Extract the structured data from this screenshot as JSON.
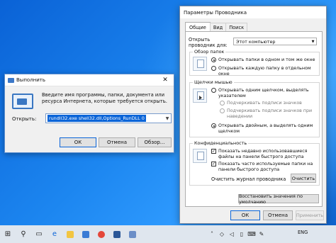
{
  "run_dialog": {
    "title": "Выполнить",
    "description": "Введите имя программы, папки, документа или ресурса Интернета, которые требуется открыть.",
    "open_label": "Открыть:",
    "open_value": "rundll32.exe shell32.dll,Options_RunDLL 0",
    "ok_label": "ОК",
    "cancel_label": "Отмена",
    "browse_label": "Обзор..."
  },
  "folder_options": {
    "title": "Параметры Проводника",
    "tabs": [
      "Общие",
      "Вид",
      "Поиск"
    ],
    "open_explorer_for_label": "Открыть проводник для:",
    "open_explorer_for_value": "Этот компьютер",
    "browse_folders": {
      "legend": "Обзор папок",
      "option_same_window": "Открывать папки в одном и том же окне",
      "option_new_window": "Открывать каждую папку в отдельном окне"
    },
    "clicks": {
      "legend": "Щелчки мышью",
      "option_single_click": "Открывать одним щелчком, выделять указателем",
      "sub_underline_like_browser": "Подчеркивать подписи значков",
      "sub_underline_on_hover": "Подчеркивать подписи значков при наведении",
      "option_double_click": "Открывать двойным, а выделять одним щелчком"
    },
    "privacy": {
      "legend": "Конфиденциальность",
      "check_recent_files": "Показать недавно использовавшиеся файлы на панели быстрого доступа",
      "check_frequent_folders": "Показать часто используемые папки на панели быстрого доступа",
      "clear_history_label": "Очистить журнал проводника",
      "clear_button": "Очистить"
    },
    "restore_defaults_button": "Восстановить значения по умолчанию",
    "ok_button": "ОК",
    "cancel_button": "Отмена",
    "apply_button": "Применить"
  },
  "taskbar": {
    "icons": [
      "windows-start-icon",
      "search-icon",
      "task-view-icon",
      "edge-icon",
      "explorer-icon",
      "store-icon",
      "word-icon",
      "chrome-icon"
    ],
    "language": "ENG"
  },
  "colors": {
    "accent": "#0a64d8",
    "desktop": "#1c86f0"
  }
}
